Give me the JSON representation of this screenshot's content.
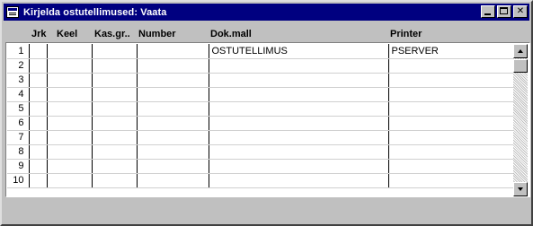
{
  "window": {
    "title": "Kirjelda ostutellimused: Vaata"
  },
  "columns": [
    "Jrk",
    "Keel",
    "Kas.gr..",
    "Number",
    "Dok.mall",
    "Printer"
  ],
  "rows": [
    {
      "n": "1",
      "jrk": "",
      "keel": "",
      "kasgr": "",
      "number": "",
      "dokmall": "OSTUTELLIMUS",
      "printer": "PSERVER"
    },
    {
      "n": "2",
      "jrk": "",
      "keel": "",
      "kasgr": "",
      "number": "",
      "dokmall": "",
      "printer": ""
    },
    {
      "n": "3",
      "jrk": "",
      "keel": "",
      "kasgr": "",
      "number": "",
      "dokmall": "",
      "printer": ""
    },
    {
      "n": "4",
      "jrk": "",
      "keel": "",
      "kasgr": "",
      "number": "",
      "dokmall": "",
      "printer": ""
    },
    {
      "n": "5",
      "jrk": "",
      "keel": "",
      "kasgr": "",
      "number": "",
      "dokmall": "",
      "printer": ""
    },
    {
      "n": "6",
      "jrk": "",
      "keel": "",
      "kasgr": "",
      "number": "",
      "dokmall": "",
      "printer": ""
    },
    {
      "n": "7",
      "jrk": "",
      "keel": "",
      "kasgr": "",
      "number": "",
      "dokmall": "",
      "printer": ""
    },
    {
      "n": "8",
      "jrk": "",
      "keel": "",
      "kasgr": "",
      "number": "",
      "dokmall": "",
      "printer": ""
    },
    {
      "n": "9",
      "jrk": "",
      "keel": "",
      "kasgr": "",
      "number": "",
      "dokmall": "",
      "printer": ""
    },
    {
      "n": "10",
      "jrk": "",
      "keel": "",
      "kasgr": "",
      "number": "",
      "dokmall": "",
      "printer": ""
    }
  ]
}
